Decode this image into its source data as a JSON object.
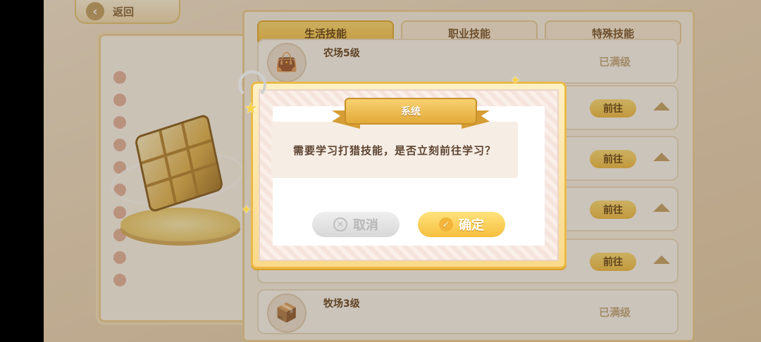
{
  "header": {
    "back_label": "返回"
  },
  "tabs": [
    {
      "label": "生活技能",
      "active": true
    },
    {
      "label": "职业技能",
      "active": false
    },
    {
      "label": "特殊技能",
      "active": false
    }
  ],
  "skill_rows": [
    {
      "name": "农场5级",
      "status": "已满级",
      "icon": "sack-icon"
    },
    {
      "name": "",
      "action": "前往",
      "icon": ""
    },
    {
      "name": "",
      "action": "前往",
      "icon": ""
    },
    {
      "name": "",
      "action": "前往",
      "icon": ""
    },
    {
      "name": "",
      "action": "前往",
      "icon": ""
    },
    {
      "name": "牧场3级",
      "status": "已满级",
      "icon": "crate-icon"
    }
  ],
  "dialog": {
    "title": "系统",
    "message": "需要学习打猎技能，是否立刻前往学习？",
    "cancel_label": "取消",
    "confirm_label": "确定"
  },
  "colors": {
    "accent": "#f7c54b",
    "background": "#efdcc0",
    "text_dark": "#5c4330"
  }
}
